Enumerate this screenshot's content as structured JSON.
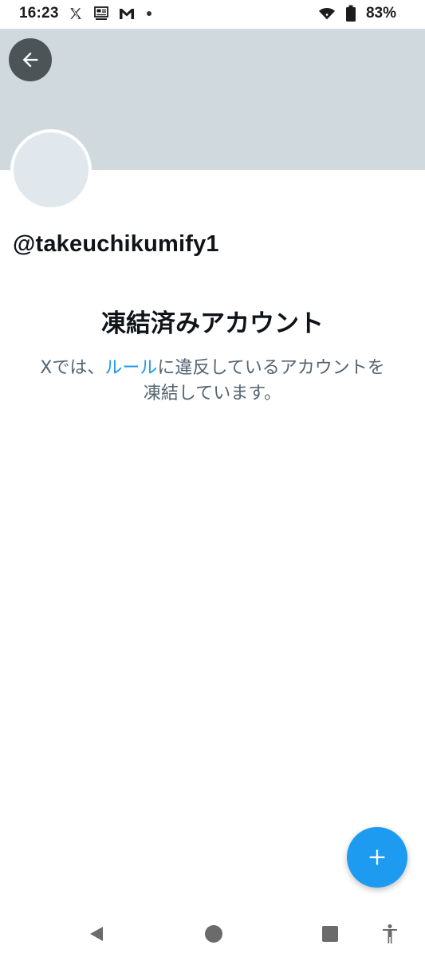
{
  "status_bar": {
    "time": "16:23",
    "battery_percent": "83%",
    "notification_icons": [
      "x-logo-icon",
      "news-app-icon",
      "gmail-icon",
      "more-dot-icon"
    ],
    "system_icons": [
      "wifi-icon",
      "battery-icon"
    ]
  },
  "profile": {
    "handle": "@takeuchikumify1",
    "banner_color": "#cfd9de"
  },
  "notice": {
    "title": "凍結済みアカウント",
    "body_prefix": "Xでは、",
    "rules_link": "ルール",
    "body_suffix": "に違反しているアカウントを凍結しています。"
  },
  "colors": {
    "accent": "#1d9bf0",
    "secondary_text": "#536471",
    "primary_text": "#0f1419"
  },
  "navigation": {
    "icons": [
      "back-triangle-icon",
      "home-circle-icon",
      "recents-square-icon",
      "accessibility-icon"
    ]
  },
  "fab": {
    "icon": "plus-icon"
  }
}
